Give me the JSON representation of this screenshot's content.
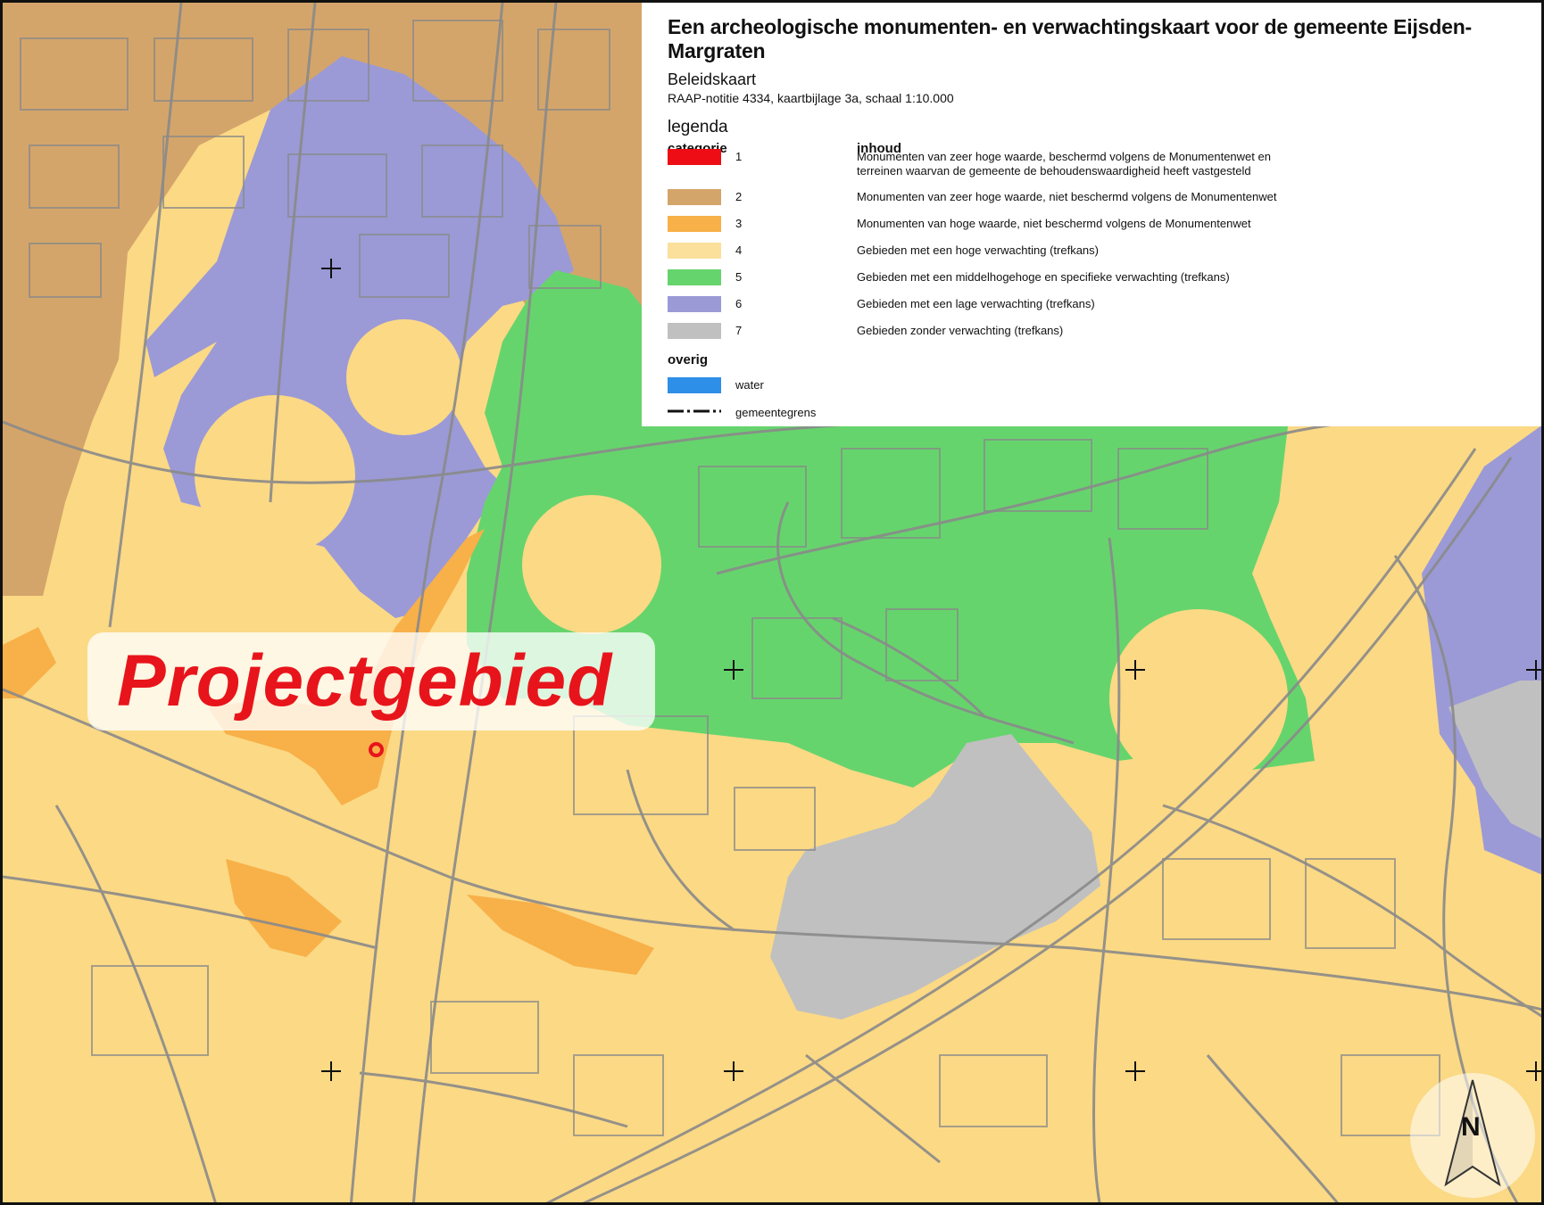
{
  "legend": {
    "title": "Een archeologische monumenten- en verwachtingskaart voor de gemeente Eijsden-Margraten",
    "subtitle": "Beleidskaart",
    "note": "RAAP-notitie 4334, kaartbijlage 3a, schaal 1:10.000",
    "legenda_label": "legenda",
    "col_categorie": "categorie",
    "col_inhoud": "inhoud",
    "categories": [
      {
        "num": "1",
        "color": "#ee0d14",
        "text": "Monumenten van zeer hoge waarde, beschermd volgens de Monumentenwet en",
        "text2": "terreinen waarvan de gemeente de behoudenswaardigheid heeft vastgesteld"
      },
      {
        "num": "2",
        "color": "#d4a56a",
        "text": "Monumenten van zeer hoge waarde, niet beschermd volgens de Monumentenwet",
        "text2": ""
      },
      {
        "num": "3",
        "color": "#f8b048",
        "text": "Monumenten van hoge waarde, niet beschermd volgens de Monumentenwet",
        "text2": ""
      },
      {
        "num": "4",
        "color": "#fbe09c",
        "text": "Gebieden met een hoge verwachting (trefkans)",
        "text2": ""
      },
      {
        "num": "5",
        "color": "#66d46d",
        "text": "Gebieden met een middelhogehoge en specifieke verwachting (trefkans)",
        "text2": ""
      },
      {
        "num": "6",
        "color": "#9b9ad6",
        "text": "Gebieden met een lage verwachting (trefkans)",
        "text2": ""
      },
      {
        "num": "7",
        "color": "#c0c0c0",
        "text": "Gebieden zonder verwachting (trefkans)",
        "text2": ""
      }
    ],
    "overig_label": "overig",
    "water_label": "water",
    "water_color": "#2d8fe8",
    "grens_label": "gemeentegrens"
  },
  "map": {
    "project_label": "Projectgebied",
    "north_label": "N",
    "colors": {
      "high": "#fbd985",
      "monument2": "#d4a56a",
      "monument3": "#f8b048",
      "medium": "#66d46d",
      "low": "#9b9ad6",
      "none": "#c0c0c0",
      "parcel_lines": "#8a8a8a",
      "project_label": "#e8141b"
    }
  }
}
